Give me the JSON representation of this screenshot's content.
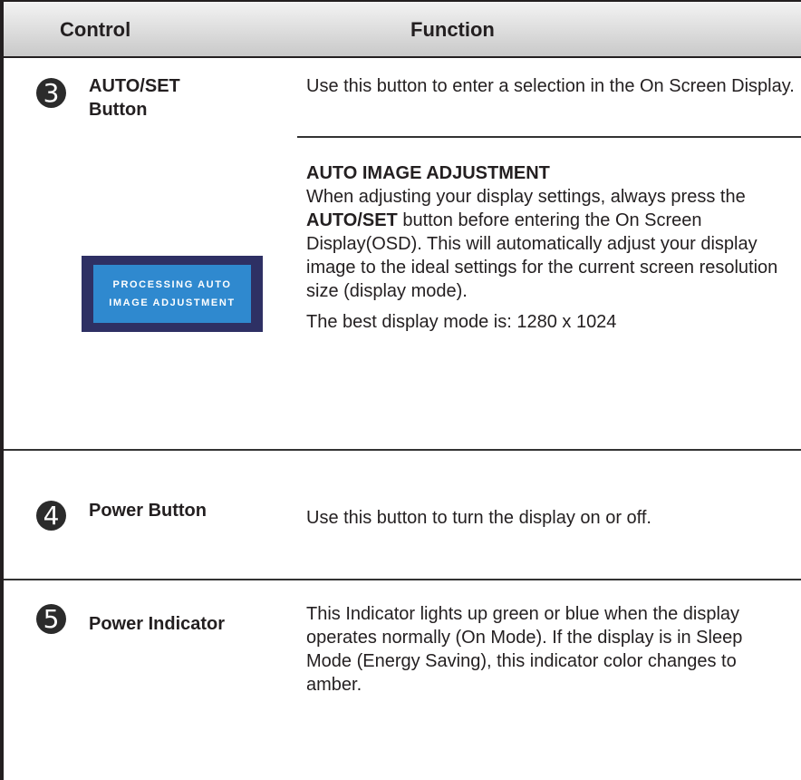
{
  "header": {
    "control_label": "Control",
    "function_label": "Function"
  },
  "rows": [
    {
      "number": "3",
      "control": [
        "AUTO/SET",
        "Button"
      ],
      "function_intro": "Use this button to enter a selection in the On Screen Display.",
      "subsection": {
        "title": "AUTO IMAGE ADJUSTMENT",
        "text_1": "When adjusting your display settings, always press the ",
        "text_bold": "AUTO/SET",
        "text_2": " button before entering the On Screen Display(OSD). This will automatically adjust your display image to the ideal settings for the current screen resolution size (display mode).",
        "best_mode": "The best display mode is: 1280 x 1024"
      },
      "osd": {
        "line_1": "PROCESSING AUTO",
        "line_2": "IMAGE ADJUSTMENT"
      }
    },
    {
      "number": "4",
      "control": [
        "Power Button"
      ],
      "function_text": "Use this button to turn the display on or off."
    },
    {
      "number": "5",
      "control": [
        "Power Indicator"
      ],
      "function_text": "This Indicator lights up green or blue when the display operates normally (On Mode). If the display is in Sleep Mode (Energy Saving), this indicator color changes to amber."
    }
  ]
}
